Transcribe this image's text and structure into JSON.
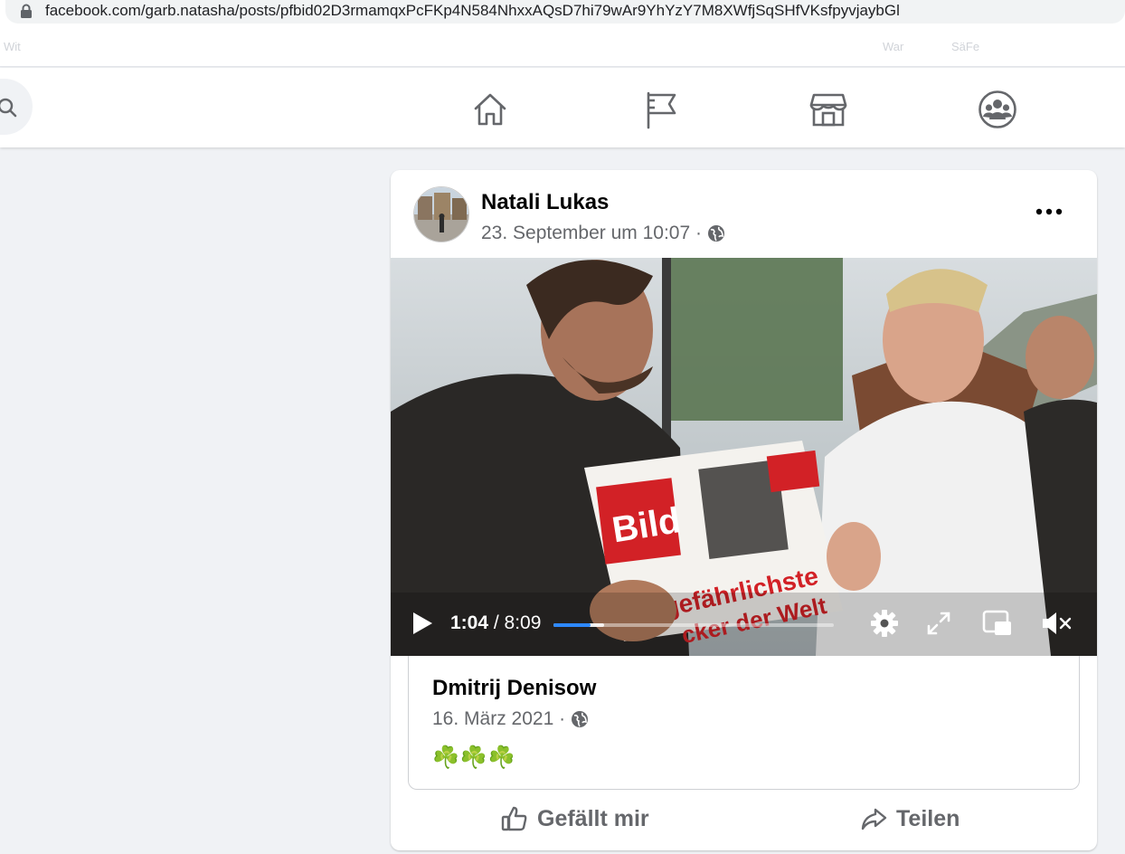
{
  "browser": {
    "url": "facebook.com/garb.natasha/posts/pfbid02D3rmamqxPcFKp4N584NhxxAQsD7hi79wAr9YhYzY7M8XWfjSqSHfVKsfpyvjaybGl",
    "bookmarks": [
      "Wit",
      "War",
      "SäFe"
    ]
  },
  "nav": {
    "icons": [
      "home-icon",
      "pages-flag-icon",
      "marketplace-icon",
      "groups-icon"
    ]
  },
  "post": {
    "author": "Natali Lukas",
    "date": "23. September um 10:07 ·",
    "video": {
      "current_time": "1:04",
      "separator": " / ",
      "duration": "8:09",
      "progress_fraction": 0.131,
      "buffered_fraction": 0.18
    },
    "shared": {
      "author": "Dmitrij Denisow",
      "date": "16. März 2021 ·",
      "text": "☘️☘️☘️"
    },
    "actions": {
      "like": "Gefällt mir",
      "share": "Teilen"
    }
  },
  "colors": {
    "accent": "#2d88ff",
    "secondary_text": "#65676b",
    "nav_icon": "#65676b"
  }
}
